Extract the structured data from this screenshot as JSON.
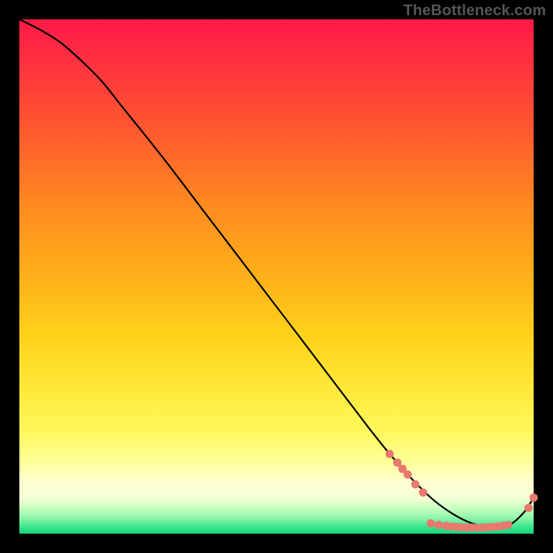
{
  "watermark": "TheBottleneck.com",
  "colors": {
    "dot": "#e8796f",
    "line": "#000000",
    "frame_bg": "#000000"
  },
  "chart_data": {
    "type": "line",
    "title": "",
    "xlabel": "",
    "ylabel": "",
    "xlim": [
      0,
      100
    ],
    "ylim": [
      0,
      100
    ],
    "grid": false,
    "legend": false,
    "series": [
      {
        "name": "curve",
        "x": [
          0,
          4,
          8,
          12,
          16,
          20,
          28,
          36,
          44,
          52,
          60,
          68,
          72,
          76,
          80,
          84,
          88,
          92,
          95,
          98,
          100
        ],
        "y": [
          100,
          98,
          95.5,
          92,
          88,
          83,
          73,
          62.5,
          52,
          41.5,
          31,
          20.5,
          15.5,
          11,
          7,
          4,
          2,
          1.2,
          1.5,
          4,
          7
        ]
      }
    ],
    "marker_clusters": [
      {
        "name": "upper-cluster",
        "x": [
          72,
          73.5,
          74.5,
          75.5,
          77,
          78.5
        ],
        "y": [
          15.5,
          13.8,
          12.6,
          11.5,
          9.6,
          8.0
        ]
      },
      {
        "name": "bottom-trough",
        "x": [
          80,
          81.5,
          83,
          84,
          85,
          86,
          87,
          88,
          89,
          90,
          91,
          92,
          93,
          94,
          95
        ],
        "y": [
          2.0,
          1.7,
          1.5,
          1.4,
          1.3,
          1.25,
          1.2,
          1.2,
          1.2,
          1.2,
          1.25,
          1.3,
          1.4,
          1.5,
          1.7
        ]
      },
      {
        "name": "tail-up",
        "x": [
          99,
          100
        ],
        "y": [
          5.0,
          7.0
        ]
      }
    ]
  }
}
